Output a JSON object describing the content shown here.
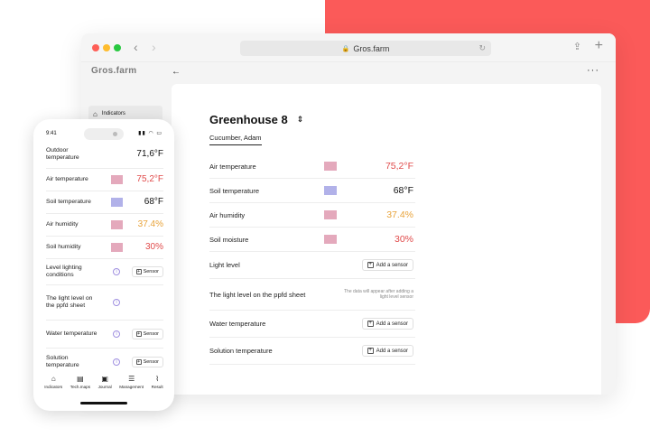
{
  "browser": {
    "url": "Gros.farm",
    "lock_icon": "lock-icon",
    "reload_icon": "reload-icon",
    "share_icon": "share-icon",
    "new_tab_icon": "plus-icon"
  },
  "app": {
    "logo": "Gros.farm",
    "sidebar": {
      "active_item": "Indicators",
      "active_icon": "home-icon"
    },
    "more_icon": "ellipsis-icon"
  },
  "greenhouse": {
    "title": "Greenhouse 8",
    "crop": "Cucumber, Adam",
    "rows": [
      {
        "label": "Air temperature",
        "value": "75,2°F",
        "status": "alert"
      },
      {
        "label": "Soil temperature",
        "value": "68°F",
        "status": "normal"
      },
      {
        "label": "Air humidity",
        "value": "37.4%",
        "status": "warning"
      },
      {
        "label": "Soil moisture",
        "value": "30%",
        "status": "alert"
      },
      {
        "label": "Light level",
        "action": "Add a sensor"
      },
      {
        "label": "The light level on the ppfd sheet",
        "note": "The data will appear after adding a light level sensor"
      },
      {
        "label": "Water temperature",
        "action": "Add a sensor"
      },
      {
        "label": "Solution temperature",
        "action": "Add a sensor"
      }
    ]
  },
  "phone": {
    "time": "9:41",
    "rows": [
      {
        "label": "Outdoor temperature",
        "value": "71,6°F"
      },
      {
        "label": "Air temperature",
        "value": "75,2°F"
      },
      {
        "label": "Soil temperature",
        "value": "68°F"
      },
      {
        "label": "Air humidity",
        "value": "37.4%"
      },
      {
        "label": "Soil humidity",
        "value": "30%"
      },
      {
        "label": "Level lighting conditions",
        "action": "Sensor"
      },
      {
        "label": "The light level on the ppfd sheet"
      },
      {
        "label": "Water temperature",
        "action": "Sensor"
      },
      {
        "label": "Solution temperature",
        "action": "Sensor"
      }
    ],
    "tabs": [
      {
        "label": "Indicators",
        "icon": "home-icon"
      },
      {
        "label": "Tech.maps",
        "icon": "map-icon"
      },
      {
        "label": "Journal",
        "icon": "journal-icon"
      },
      {
        "label": "Management",
        "icon": "sliders-icon"
      },
      {
        "label": "Result",
        "icon": "chart-icon"
      }
    ]
  },
  "colors": {
    "accent_red": "#fb5a59",
    "alert": "#e04a4a",
    "warning": "#e8a33a"
  }
}
